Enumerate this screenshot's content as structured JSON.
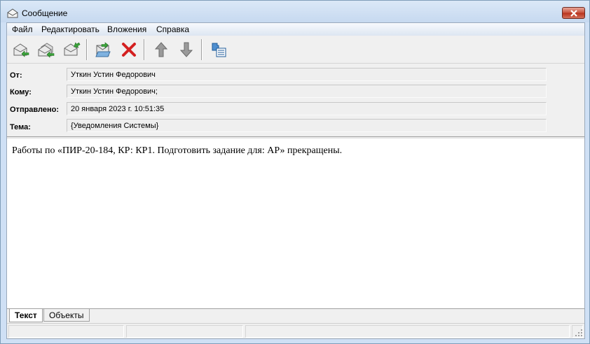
{
  "window": {
    "title": "Сообщение"
  },
  "menu": [
    "Файл",
    "Редактировать",
    "Вложения",
    "Справка"
  ],
  "toolbar": {
    "buttons": [
      "reply-icon",
      "reply-all-icon",
      "forward-icon",
      "save-to-folder-icon",
      "delete-icon",
      "up-arrow-icon",
      "down-arrow-icon",
      "object-properties-icon"
    ]
  },
  "headers": {
    "from": {
      "label": "От:",
      "value": "Уткин Устин Федорович"
    },
    "to": {
      "label": "Кому:",
      "value": "Уткин Устин Федорович;"
    },
    "sent": {
      "label": "Отправлено:",
      "value": "20 января 2023 г. 10:51:35"
    },
    "subject": {
      "label": "Тема:",
      "value": "{Уведомления Системы}"
    }
  },
  "body": {
    "text": "Работы по «ПИР-20-184, КР: КР1. Подготовить задание для: АР» прекращены."
  },
  "tabs": {
    "text": "Текст",
    "objects": "Объекты"
  },
  "colors": {
    "delete": "#d42020",
    "accent_green": "#3aa33a",
    "arrow_gray": "#8a8a8a"
  }
}
